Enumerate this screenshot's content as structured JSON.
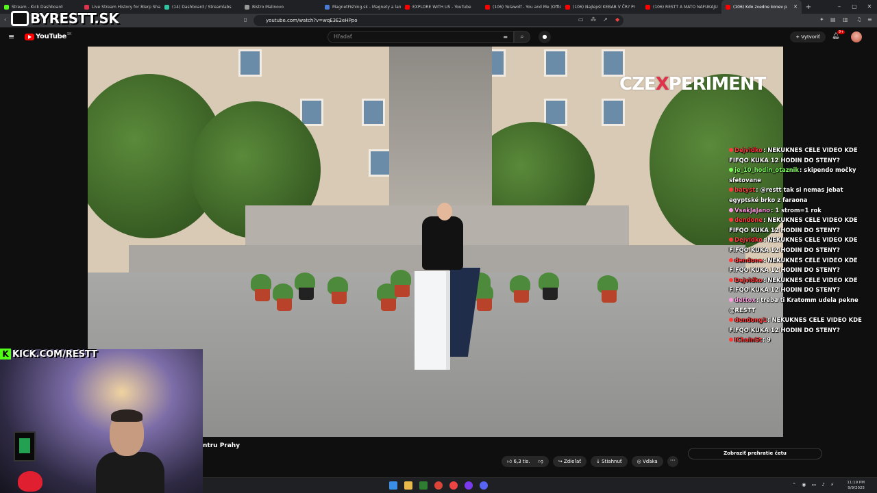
{
  "browser": {
    "tabs": [
      {
        "label": "Stream - Kick Dashboard",
        "color": "#53fc18"
      },
      {
        "label": "Live Stream History for Blerp Share",
        "color": "#e0324b"
      },
      {
        "label": "(14) Dashboard / Streamlabs",
        "color": "#31c3a2"
      },
      {
        "label": "Bistro Malinovo",
        "color": "#999999"
      },
      {
        "label": "MagnetFishing.sk - Magnety a lan",
        "color": "#4a7bd8"
      },
      {
        "label": "EXPLORE WITH US - YouTube",
        "color": "#ff0000"
      },
      {
        "label": "(106) Yelawolf - You and Me (Offic",
        "color": "#ff0000"
      },
      {
        "label": "(106) Najlepší KEBAB V ČR? Pr",
        "color": "#ff0000"
      },
      {
        "label": "(106) RESTT A MATO NAFUKAJU",
        "color": "#ff0000"
      },
      {
        "label": "(106) Kdo zvedne konev p",
        "color": "#ff0000"
      }
    ],
    "new_tab": "+",
    "window_controls": [
      "–",
      "▢",
      "✕"
    ],
    "url": "youtube.com/watch?v=wqE3E2eHPpo"
  },
  "youtube": {
    "logo_text": "YouTube",
    "region": "SK",
    "search_placeholder": "Hľadať",
    "create_label": "Vytvoriť",
    "notification_count": "9+"
  },
  "overlay": {
    "brand_text": "BYRESTT.SK",
    "kick_text": "KICK.COM/RESTT",
    "kick_k": "K",
    "watermark_a": "CZE",
    "watermark_x": "X",
    "watermark_b": "PERIMENT"
  },
  "chat": [
    {
      "user": "Dejvidko",
      "color": "#ff3b3b",
      "text": "NEKUKNES CELE VIDEO KDE FIFQO KUKA 12 HODIN DO STENY?"
    },
    {
      "user": "je_10_hodin_otaznik",
      "color": "#7cfc5a",
      "text": "skipendo močky sfetovane"
    },
    {
      "user": "batyst",
      "color": "#ff3b3b",
      "text": "@restt tak si nemas jebat egyptské brko z faraona"
    },
    {
      "user": "VsakJaJano",
      "color": "#ff9be0",
      "text": "1 strom=1 rok"
    },
    {
      "user": "dendone",
      "color": "#ff3b3b",
      "text": "NEKUKNES CELE VIDEO KDE FIFQO KUKA 12 HODIN DO STENY?"
    },
    {
      "user": "Dejvidko",
      "color": "#ff3b3b",
      "text": "NEKUKNES CELE VIDEO KDE FIFQO KUKA 12 HODIN DO STENY?"
    },
    {
      "user": "dendone",
      "color": "#ff3b3b",
      "text": "NEKUKNES CELE VIDEO KDE FIFQO KUKA 12 HODIN DO STENY?"
    },
    {
      "user": "Dejvidko",
      "color": "#ff3b3b",
      "text": "NEKUKNES CELE VIDEO KDE FIFQO KUKA 12 HODIN DO STENY?"
    },
    {
      "user": "dettox",
      "color": "#ff9be0",
      "text": "treba ti Kratomm udela pekne @RESTT"
    },
    {
      "user": "dendong1",
      "color": "#ff3b3b",
      "text": "NEKUKNES CELE VIDEO KDE FIFQO KUKA 12 HODIN DO STENY?"
    },
    {
      "user": "IChainSt",
      "color": "#ff3b3b",
      "text": "9"
    }
  ],
  "video": {
    "title_fragment": "ntru Prahy",
    "likes": "6,3 tis.",
    "share_label": "Zdieľať",
    "download_label": "Stiahnuť",
    "thanks_label": "Vďaka",
    "more": "···",
    "chat_replay_label": "Zobraziť prehratie četu"
  },
  "taskbar": {
    "time": "11:19 PM",
    "date": "9/9/2025"
  }
}
